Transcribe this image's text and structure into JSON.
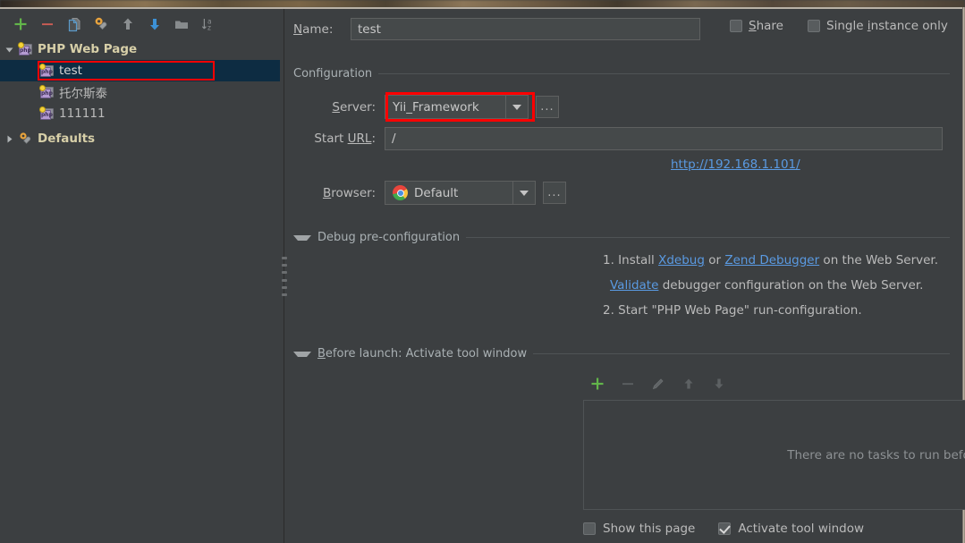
{
  "window": {
    "title_hidden": true
  },
  "left_toolbar": {
    "buttons": [
      {
        "name": "add-configuration",
        "icon": "plus-icon",
        "tooltip": "Add New Configuration"
      },
      {
        "name": "remove-configuration",
        "icon": "minus-icon",
        "tooltip": "Remove Configuration"
      },
      {
        "name": "copy-configuration",
        "icon": "copy-icon",
        "tooltip": "Copy Configuration"
      },
      {
        "name": "edit-defaults",
        "icon": "gear-wrench-icon",
        "tooltip": "Edit defaults"
      },
      {
        "name": "move-up",
        "icon": "arrow-up-icon",
        "tooltip": "Move Up"
      },
      {
        "name": "move-down",
        "icon": "arrow-down-icon",
        "tooltip": "Move Down"
      },
      {
        "name": "create-folder",
        "icon": "folder-icon",
        "tooltip": "Create New Folder"
      },
      {
        "name": "sort-configurations",
        "icon": "sort-az-icon",
        "tooltip": "Sort Configurations"
      }
    ]
  },
  "tree": {
    "nodes": [
      {
        "label": "PHP Web Page",
        "icon": "php-icon",
        "expanded": true,
        "level": 0,
        "style": "root",
        "selected": false
      },
      {
        "label": "test",
        "icon": "php-icon",
        "level": 1,
        "style": "white",
        "selected": true,
        "highlighted": true
      },
      {
        "label": "托尔斯泰",
        "icon": "php-icon",
        "level": 1,
        "style": "normal",
        "selected": false
      },
      {
        "label": "111111",
        "icon": "php-icon",
        "level": 1,
        "style": "normal",
        "selected": false
      },
      {
        "label": "Defaults",
        "icon": "gear-wrench-icon",
        "expanded": false,
        "level": 0,
        "style": "root",
        "selected": false
      }
    ]
  },
  "form": {
    "name_label": "Name:",
    "name_label_mnemonic": "N",
    "name_value": "test",
    "share_label": "Share",
    "share_mnemonic": "S",
    "share_checked": false,
    "single_instance_label_pre": "Single ",
    "single_instance_mnemonic": "i",
    "single_instance_label_post": "nstance only",
    "single_instance_checked": false
  },
  "configuration": {
    "section_title": "Configuration",
    "server_label": "Server:",
    "server_mnemonic": "S",
    "server_value": "Yii_Framework",
    "server_highlighted": true,
    "server_browse_label": "...",
    "start_url_label_pre": "Start ",
    "start_url_mnemonic": "URL",
    "start_url_label_post": ":",
    "start_url_value": "/",
    "resolved_url": "http://192.168.1.101/",
    "browser_label": "Browser:",
    "browser_mnemonic": "B",
    "browser_value": "Default",
    "browser_icon": "chrome-icon",
    "browser_browse_label": "..."
  },
  "debug_section": {
    "title": "Debug pre-configuration",
    "line1_pre": "1. Install ",
    "line1_link1": "Xdebug",
    "line1_mid": " or ",
    "line1_link2": "Zend Debugger",
    "line1_post": " on the Web Server.",
    "line2_link": "Validate",
    "line2_post": " debugger configuration on the Web Server.",
    "line3": "2. Start \"PHP Web Page\" run-configuration."
  },
  "before_launch": {
    "title_mnemonic": "B",
    "title_rest": "efore launch: Activate tool window",
    "toolbar": [
      {
        "name": "add-task-button",
        "icon": "plus-icon",
        "enabled": true
      },
      {
        "name": "remove-task-button",
        "icon": "minus-icon",
        "enabled": false
      },
      {
        "name": "edit-task-button",
        "icon": "pencil-icon",
        "enabled": false
      },
      {
        "name": "move-task-up-button",
        "icon": "arrow-up-icon",
        "enabled": false
      },
      {
        "name": "move-task-down-button",
        "icon": "arrow-down-icon",
        "enabled": false
      }
    ],
    "empty_text": "There are no tasks to run before launch",
    "show_this_page_label": "Show this page",
    "show_this_page_checked": false,
    "activate_tool_window_label": "Activate tool window",
    "activate_tool_window_checked": true
  },
  "colors": {
    "background": "#3c3f41",
    "selection": "#0d2c42",
    "highlight_ring": "#ff0000",
    "link": "#5a9ae2",
    "accent_green": "#62b54a",
    "accent_red": "#d0554f",
    "root_label": "#d7cfa8"
  }
}
